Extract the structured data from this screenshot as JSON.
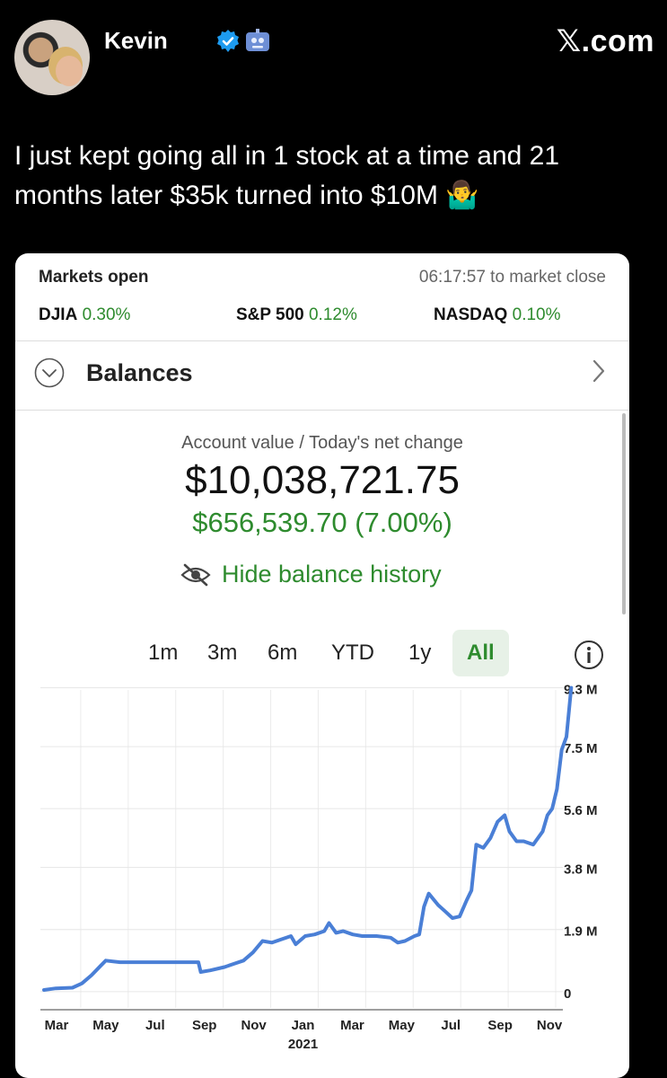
{
  "tweet": {
    "author": "Kevin",
    "brand": "𝕏.com",
    "text": "I just kept going all in 1 stock at a time and 21 months later $35k turned into $10M 🤷‍♂️",
    "icons": [
      "verified-badge-icon",
      "robot-emoji-icon"
    ]
  },
  "app": {
    "market_status": "Markets open",
    "market_close": "06:17:57 to market close",
    "indices": [
      {
        "name": "DJIA",
        "change": "0.30%"
      },
      {
        "name": "S&P 500",
        "change": "0.12%"
      },
      {
        "name": "NASDAQ",
        "change": "0.10%"
      }
    ],
    "section_title": "Balances",
    "account_label": "Account value / Today's net change",
    "account_value": "$10,038,721.75",
    "net_change": "$656,539.70 (7.00%)",
    "hide_history_label": "Hide balance history",
    "ranges": [
      "1m",
      "3m",
      "6m",
      "YTD",
      "1y",
      "All"
    ],
    "active_range": "All",
    "colors": {
      "accent_green": "#2e8b2e",
      "line_blue": "#4a7fd6"
    }
  },
  "chart_data": {
    "type": "line",
    "x_ticks": [
      "Mar",
      "May",
      "Jul",
      "Sep",
      "Nov",
      "Jan",
      "Mar",
      "May",
      "Jul",
      "Sep",
      "Nov"
    ],
    "x_year_label": "2021",
    "y_ticks": [
      "0",
      "1.9 M",
      "3.8 M",
      "5.6 M",
      "7.5 M",
      "9.3 M"
    ],
    "ylim": [
      -0.5,
      9.4
    ],
    "series": [
      {
        "values": [
          [
            0,
            0.05
          ],
          [
            0.25,
            0.1
          ],
          [
            0.6,
            0.12
          ],
          [
            0.8,
            0.25
          ],
          [
            1.0,
            0.5
          ],
          [
            1.2,
            0.8
          ],
          [
            1.3,
            0.95
          ],
          [
            1.6,
            0.9
          ],
          [
            2.0,
            0.9
          ],
          [
            2.5,
            0.9
          ],
          [
            3.0,
            0.9
          ],
          [
            3.25,
            0.9
          ],
          [
            3.3,
            0.6
          ],
          [
            3.5,
            0.65
          ],
          [
            3.8,
            0.75
          ],
          [
            4.0,
            0.85
          ],
          [
            4.2,
            0.95
          ],
          [
            4.4,
            1.2
          ],
          [
            4.6,
            1.55
          ],
          [
            4.8,
            1.5
          ],
          [
            5.0,
            1.6
          ],
          [
            5.2,
            1.7
          ],
          [
            5.3,
            1.45
          ],
          [
            5.5,
            1.7
          ],
          [
            5.7,
            1.75
          ],
          [
            5.9,
            1.85
          ],
          [
            6.0,
            2.1
          ],
          [
            6.15,
            1.8
          ],
          [
            6.3,
            1.85
          ],
          [
            6.5,
            1.75
          ],
          [
            6.7,
            1.7
          ],
          [
            7.0,
            1.7
          ],
          [
            7.3,
            1.65
          ],
          [
            7.45,
            1.5
          ],
          [
            7.6,
            1.55
          ],
          [
            7.8,
            1.7
          ],
          [
            7.9,
            1.75
          ],
          [
            8.0,
            2.6
          ],
          [
            8.1,
            3.0
          ],
          [
            8.3,
            2.65
          ],
          [
            8.45,
            2.45
          ],
          [
            8.6,
            2.25
          ],
          [
            8.75,
            2.3
          ],
          [
            8.9,
            2.8
          ],
          [
            9.0,
            3.1
          ],
          [
            9.1,
            4.5
          ],
          [
            9.25,
            4.4
          ],
          [
            9.4,
            4.7
          ],
          [
            9.55,
            5.2
          ],
          [
            9.7,
            5.4
          ],
          [
            9.8,
            4.9
          ],
          [
            9.95,
            4.6
          ],
          [
            10.1,
            4.6
          ],
          [
            10.3,
            4.5
          ],
          [
            10.5,
            4.9
          ],
          [
            10.6,
            5.4
          ],
          [
            10.7,
            5.6
          ],
          [
            10.8,
            6.2
          ],
          [
            10.9,
            7.4
          ],
          [
            11.0,
            7.8
          ],
          [
            11.1,
            9.3
          ]
        ]
      }
    ]
  }
}
